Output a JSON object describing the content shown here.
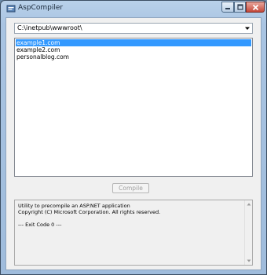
{
  "window": {
    "title": "AspCompiler",
    "icons": {
      "app": "app-icon",
      "minimize": "minimize-icon",
      "maximize": "maximize-icon",
      "close": "close-icon"
    },
    "colors": {
      "selection": "#3399ff",
      "close_button": "#c4483a"
    }
  },
  "path_combo": {
    "value": "C:\\inetpub\\wwwroot\\",
    "icon": "chevron-down-icon"
  },
  "sites": {
    "items": [
      {
        "label": "example1.com",
        "selected": true
      },
      {
        "label": "example2.com",
        "selected": false
      },
      {
        "label": "personalblog.com",
        "selected": false
      }
    ]
  },
  "compile_button": {
    "label": "Compile",
    "enabled": false
  },
  "output": {
    "lines": [
      "Utility to precompile an ASP.NET application",
      "Copyright (C) Microsoft Corporation. All rights reserved.",
      "",
      "--- Exit Code 0 ---"
    ]
  }
}
